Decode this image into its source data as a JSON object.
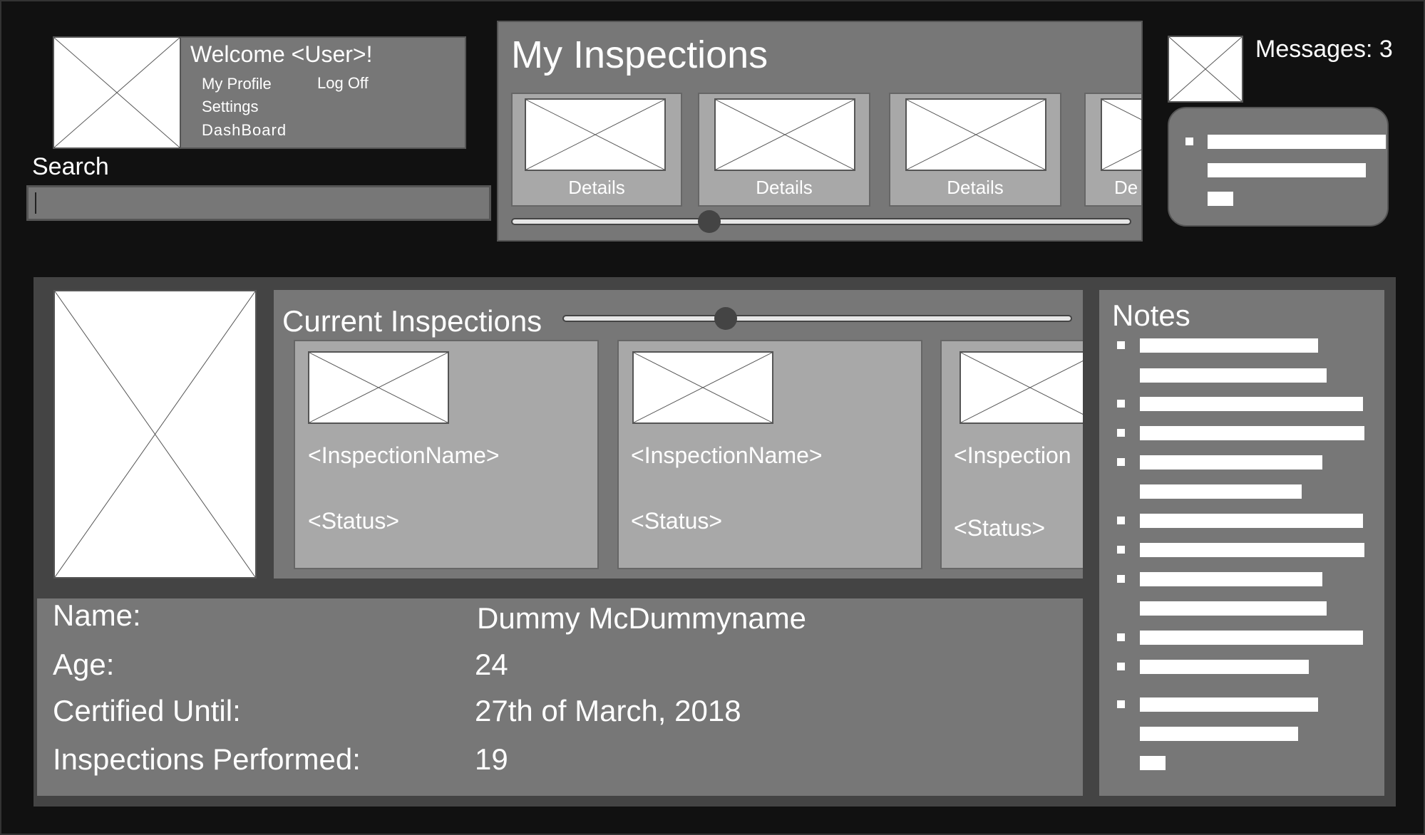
{
  "user": {
    "welcome": "Welcome <User>!",
    "my_profile": "My Profile",
    "log_off": "Log Off",
    "settings": "Settings",
    "dashboard": "DashBoard"
  },
  "search": {
    "label": "Search",
    "value": ""
  },
  "my_inspections": {
    "title": "My Inspections",
    "cards": [
      "Details",
      "Details",
      "Details",
      "De"
    ],
    "slider_fraction": 0.32
  },
  "messages": {
    "label": "Messages: 3"
  },
  "current_inspections": {
    "title": "Current Inspections",
    "slider_fraction": 0.32,
    "cards": [
      {
        "name": "<InspectionName>",
        "status": "<Status>"
      },
      {
        "name": "<InspectionName>",
        "status": "<Status>"
      },
      {
        "name": "<Inspection",
        "status": "<Status>"
      }
    ]
  },
  "profile": {
    "rows": [
      {
        "label": "Name:",
        "value": "Dummy McDummyname"
      },
      {
        "label": "Age:",
        "value": "24"
      },
      {
        "label": "Certified Until:",
        "value": "27th of March, 2018"
      },
      {
        "label": "Inspections Performed:",
        "value": "19"
      }
    ]
  },
  "notes": {
    "title": "Notes"
  }
}
